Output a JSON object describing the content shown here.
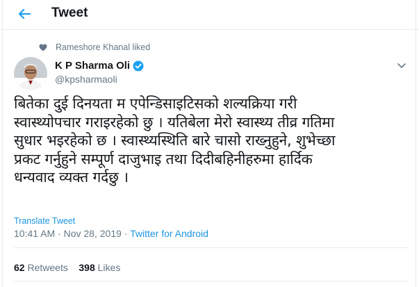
{
  "header": {
    "title": "Tweet"
  },
  "social_context": {
    "text": "Rameshore Khanal liked"
  },
  "author": {
    "name": "K P Sharma Oli",
    "handle": "@kpsharmaoli"
  },
  "tweet": {
    "lines": [
      "बितेका दुई दिनयता म एपेन्डिसाइटिसको शल्यक्रिया गरी",
      "स्वास्थ्योपचार गराइरहेको छु । यतिबेला मेरो स्वास्थ्य तीव्र गतिमा",
      "सुधार भइरहेको छ । स्वास्थ्यस्थिति बारे चासो राख्नुहुने, शुभेच्छा",
      "प्रकट गर्नुहुने सम्पूर्ण दाजुभाइ तथा दिदीबहिनीहरुमा हार्दिक",
      "धन्यवाद व्यक्त गर्दछु ।"
    ],
    "translate_label": "Translate Tweet",
    "time": "10:41 AM",
    "separator": " · ",
    "date": "Nov 28, 2019",
    "source": "Twitter for Android"
  },
  "stats": {
    "retweets_count": "62",
    "retweets_label": "Retweets",
    "likes_count": "398",
    "likes_label": "Likes"
  },
  "colors": {
    "accent": "#1da1f2",
    "link": "#1b95e0",
    "muted": "#657786",
    "text": "#14171a",
    "border": "#e6ecf0"
  },
  "icons": {
    "back": "arrow-left-icon",
    "social": "heart-icon",
    "verified": "verified-badge-icon",
    "caret": "chevron-down-icon"
  }
}
